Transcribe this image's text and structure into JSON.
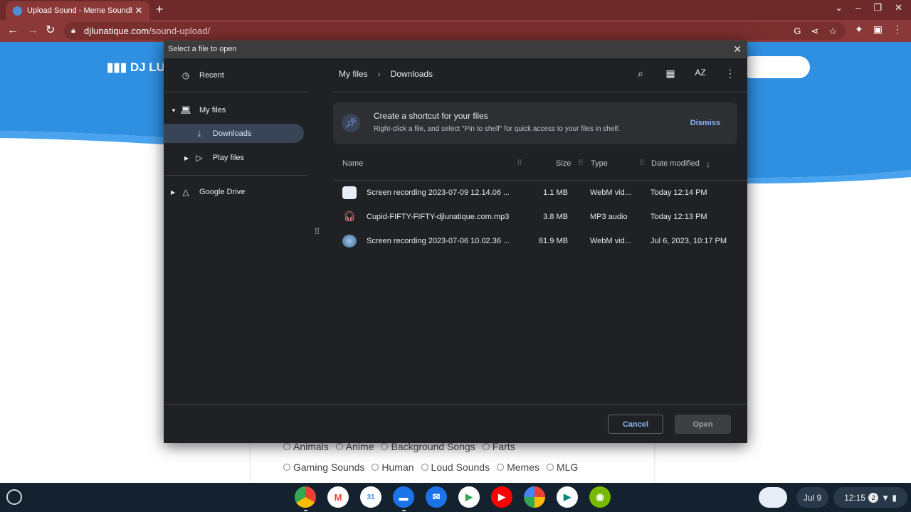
{
  "browser": {
    "tab_title": "Upload Sound - Meme Soundbo",
    "tab_close": "✕",
    "new_tab": "+",
    "url_domain": "djlunatique.com",
    "url_path": "/sound-upload/"
  },
  "page": {
    "logo_text": "DJ LUN",
    "categories_row1": [
      "Animals",
      "Anime",
      "Background Songs",
      "Farts"
    ],
    "categories_row2": [
      "Gaming Sounds",
      "Human",
      "Loud Sounds",
      "Memes",
      "MLG"
    ]
  },
  "dialog": {
    "title": "Select a file to open",
    "close": "✕",
    "sidebar": {
      "recent": "Recent",
      "my_files": "My files",
      "downloads": "Downloads",
      "play_files": "Play files",
      "google_drive": "Google Drive"
    },
    "breadcrumb": {
      "root": "My files",
      "sep": "›",
      "current": "Downloads"
    },
    "sort_label": "AZ",
    "banner": {
      "title": "Create a shortcut for your files",
      "text": "Right-click a file, and select \"Pin to shelf\" for quick access to your files in shelf.",
      "dismiss": "Dismiss"
    },
    "columns": {
      "name": "Name",
      "size": "Size",
      "type": "Type",
      "date": "Date modified",
      "sort_arrow": "↓"
    },
    "files": [
      {
        "name": "Screen recording 2023-07-09 12.14.06 ...",
        "size": "1.1 MB",
        "type": "WebM vid...",
        "date": "Today 12:14 PM"
      },
      {
        "name": "Cupid-FIFTY-FIFTY-djlunatique.com.mp3",
        "size": "3.8 MB",
        "type": "MP3 audio",
        "date": "Today 12:13 PM"
      },
      {
        "name": "Screen recording 2023-07-06 10.02.36 ...",
        "size": "81.9 MB",
        "type": "WebM vid...",
        "date": "Jul 6, 2023, 10:17 PM"
      }
    ],
    "buttons": {
      "cancel": "Cancel",
      "open": "Open"
    }
  },
  "shelf": {
    "date": "Jul 9",
    "time": "12:15",
    "notifications": "2"
  },
  "colors": {
    "accent": "#8ab4f8",
    "dialog_bg": "#202124",
    "selected_bg": "#394457",
    "browser_frame": "#8a3838",
    "page_blue": "#2f8fe0"
  }
}
